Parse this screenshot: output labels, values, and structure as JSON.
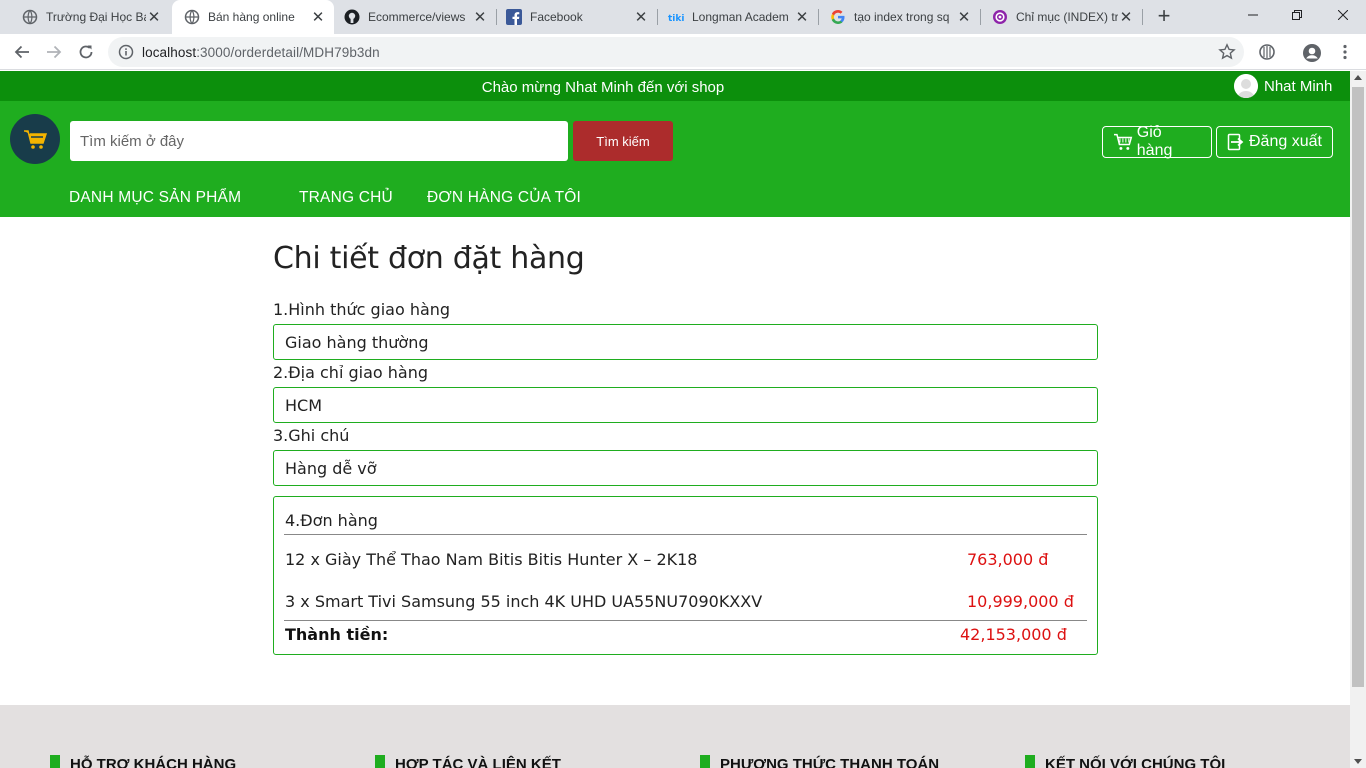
{
  "browser": {
    "tabs": [
      {
        "title": "Trường Đại Học Bá",
        "icon": "globe-icon",
        "active": false
      },
      {
        "title": "Bán hàng online",
        "icon": "globe-icon",
        "active": true
      },
      {
        "title": "Ecommerce/views",
        "icon": "github-icon",
        "active": false
      },
      {
        "title": "Facebook",
        "icon": "facebook-icon",
        "active": false
      },
      {
        "title": "Longman Academ",
        "icon": "tiki-icon",
        "active": false
      },
      {
        "title": "tạo index trong sq",
        "icon": "google-icon",
        "active": false
      },
      {
        "title": "Chỉ mục (INDEX) tr",
        "icon": "at-icon",
        "active": false
      }
    ],
    "url_host": "localhost",
    "url_path": ":3000/orderdetail/MDH79b3dn"
  },
  "topbar": {
    "welcome": "Chào mừng Nhat Minh đến với shop",
    "username": "Nhat Minh"
  },
  "header": {
    "search_placeholder": "Tìm kiếm ở đây",
    "search_button": "Tìm kiếm",
    "cart_label": "Giỏ hàng",
    "logout_label": "Đăng xuất",
    "menu": [
      "DANH MỤC SẢN PHẨM",
      "TRANG CHỦ",
      "ĐƠN HÀNG CỦA TÔI"
    ]
  },
  "order": {
    "title": "Chi tiết đơn đặt hàng",
    "shipping_label": "1.Hình thức giao hàng",
    "shipping_value": "Giao hàng thường",
    "address_label": "2.Địa chỉ giao hàng",
    "address_value": "HCM",
    "note_label": "3.Ghi chú",
    "note_value": "Hàng dễ vỡ",
    "items_label": "4.Đơn hàng",
    "items": [
      {
        "name": "12 x Giày Thể Thao Nam Bitis Bitis Hunter X – 2K18",
        "price": "763,000 đ"
      },
      {
        "name": "3 x Smart Tivi Samsung 55 inch 4K UHD UA55NU7090KXXV",
        "price": "10,999,000 đ"
      }
    ],
    "total_label": "Thành tiền:",
    "total_value": "42,153,000 đ"
  },
  "footer": {
    "columns": [
      "HỖ TRỢ KHÁCH HÀNG",
      "HỢP TÁC VÀ LIÊN KẾT",
      "PHƯƠNG THỨC THANH TOÁN",
      "KẾT NỐI VỚI CHÚNG TÔI"
    ]
  },
  "colors": {
    "header_green": "#1fad1f",
    "topbar_green": "#0c8f0c",
    "search_button": "#ac2c2c",
    "price_red": "#dd1111"
  }
}
